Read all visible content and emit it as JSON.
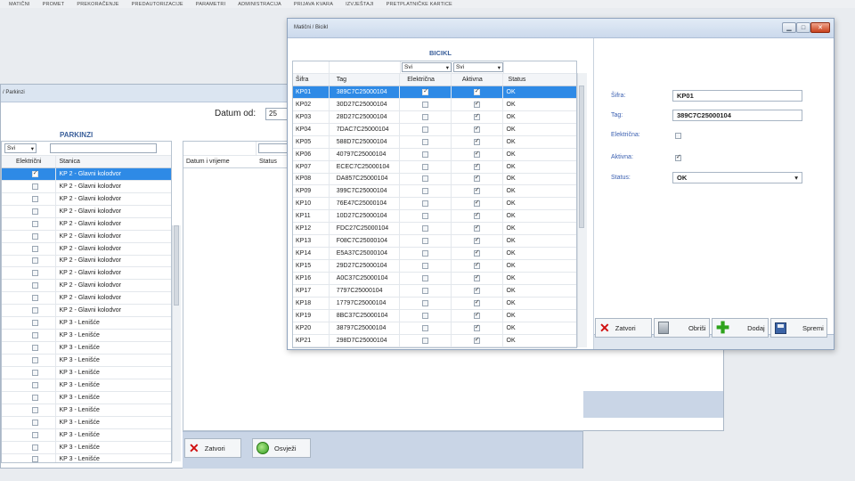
{
  "menu": [
    "MATIČNI",
    "PROMET",
    "PREKORAČENJE",
    "PREDAUTORIZACIJE",
    "PARAMETRI",
    "ADMINISTRACIJA",
    "PRIJAVA KVARA",
    "IZVJEŠTAJI",
    "PRETPLATNIČKE KARTICE"
  ],
  "parkinzi_window": {
    "title": "/ Parkinzi",
    "datum_label": "Datum od:",
    "datum_value": "25",
    "section_title": "PARKINZI",
    "filter_value": "Svi",
    "columns": [
      "Električni",
      "Stanica"
    ],
    "rows": [
      {
        "e": true,
        "station": "KP 2 - Glavni kolodvor",
        "sel": true
      },
      {
        "e": false,
        "station": "KP 2 - Glavni kolodvor"
      },
      {
        "e": false,
        "station": "KP 2 - Glavni kolodvor"
      },
      {
        "e": false,
        "station": "KP 2 - Glavni kolodvor"
      },
      {
        "e": false,
        "station": "KP 2 - Glavni kolodvor"
      },
      {
        "e": false,
        "station": "KP 2 - Glavni kolodvor"
      },
      {
        "e": false,
        "station": "KP 2 - Glavni kolodvor"
      },
      {
        "e": false,
        "station": "KP 2 - Glavni kolodvor"
      },
      {
        "e": false,
        "station": "KP 2 - Glavni kolodvor"
      },
      {
        "e": false,
        "station": "KP 2 - Glavni kolodvor"
      },
      {
        "e": false,
        "station": "KP 2 - Glavni kolodvor"
      },
      {
        "e": false,
        "station": "KP 2 - Glavni kolodvor"
      },
      {
        "e": false,
        "station": "KP 3 - Lenišće"
      },
      {
        "e": false,
        "station": "KP 3 - Lenišće"
      },
      {
        "e": false,
        "station": "KP 3 - Lenišće"
      },
      {
        "e": false,
        "station": "KP 3 - Lenišće"
      },
      {
        "e": false,
        "station": "KP 3 - Lenišće"
      },
      {
        "e": false,
        "station": "KP 3 - Lenišće"
      },
      {
        "e": false,
        "station": "KP 3 - Lenišće"
      },
      {
        "e": false,
        "station": "KP 3 - Lenišće"
      },
      {
        "e": false,
        "station": "KP 3 - Lenišće"
      },
      {
        "e": false,
        "station": "KP 3 - Lenišće"
      },
      {
        "e": false,
        "station": "KP 3 - Lenišće"
      },
      {
        "e": false,
        "station": "KP 3 - Lenišće"
      }
    ],
    "detail_columns": [
      "Datum i vrijeme",
      "Status"
    ],
    "btn_zatvori": "Zatvori",
    "btn_osvjezi": "Osvježi"
  },
  "bicikl_window": {
    "title": "Matični / Bicikl",
    "section_title": "BICIKL",
    "filter_elektricna": "Svi",
    "filter_aktivna": "Svi",
    "columns": [
      "Šifra",
      "Tag",
      "Električna",
      "Aktivna",
      "Status"
    ],
    "rows": [
      {
        "sifra": "KP01",
        "tag": "389C7C25000104",
        "e": true,
        "a": true,
        "status": "OK",
        "sel": true
      },
      {
        "sifra": "KP02",
        "tag": "30D27C25000104",
        "e": false,
        "a": true,
        "status": "OK"
      },
      {
        "sifra": "KP03",
        "tag": "28D27C25000104",
        "e": false,
        "a": true,
        "status": "OK"
      },
      {
        "sifra": "KP04",
        "tag": "7DAC7C25000104",
        "e": false,
        "a": true,
        "status": "OK"
      },
      {
        "sifra": "KP05",
        "tag": "588D7C25000104",
        "e": false,
        "a": true,
        "status": "OK"
      },
      {
        "sifra": "KP06",
        "tag": "40797C25000104",
        "e": false,
        "a": true,
        "status": "OK"
      },
      {
        "sifra": "KP07",
        "tag": "ECEC7C25000104",
        "e": false,
        "a": true,
        "status": "OK"
      },
      {
        "sifra": "KP08",
        "tag": "DA857C25000104",
        "e": false,
        "a": true,
        "status": "OK"
      },
      {
        "sifra": "KP09",
        "tag": "399C7C25000104",
        "e": false,
        "a": true,
        "status": "OK"
      },
      {
        "sifra": "KP10",
        "tag": "76E47C25000104",
        "e": false,
        "a": true,
        "status": "OK"
      },
      {
        "sifra": "KP11",
        "tag": "10D27C25000104",
        "e": false,
        "a": true,
        "status": "OK"
      },
      {
        "sifra": "KP12",
        "tag": "FDC27C25000104",
        "e": false,
        "a": true,
        "status": "OK"
      },
      {
        "sifra": "KP13",
        "tag": "F08C7C25000104",
        "e": false,
        "a": true,
        "status": "OK"
      },
      {
        "sifra": "KP14",
        "tag": "E5A37C25000104",
        "e": false,
        "a": true,
        "status": "OK"
      },
      {
        "sifra": "KP15",
        "tag": "29D27C25000104",
        "e": false,
        "a": true,
        "status": "OK"
      },
      {
        "sifra": "KP16",
        "tag": "A0C37C25000104",
        "e": false,
        "a": true,
        "status": "OK"
      },
      {
        "sifra": "KP17",
        "tag": "7797C25000104",
        "e": false,
        "a": true,
        "status": "OK"
      },
      {
        "sifra": "KP18",
        "tag": "17797C25000104",
        "e": false,
        "a": true,
        "status": "OK"
      },
      {
        "sifra": "KP19",
        "tag": "8BC37C25000104",
        "e": false,
        "a": true,
        "status": "OK"
      },
      {
        "sifra": "KP20",
        "tag": "38797C25000104",
        "e": false,
        "a": true,
        "status": "OK"
      },
      {
        "sifra": "KP21",
        "tag": "298D7C25000104",
        "e": false,
        "a": true,
        "status": "OK"
      }
    ],
    "form": {
      "sifra_label": "Šifra:",
      "sifra_value": "KP01",
      "tag_label": "Tag:",
      "tag_value": "389C7C25000104",
      "elektricna_label": "Električna:",
      "elektricna_checked": false,
      "aktivna_label": "Aktivna:",
      "aktivna_checked": true,
      "status_label": "Status:",
      "status_value": "OK"
    },
    "buttons": {
      "zatvori": "Zatvori",
      "obrisi": "Obriši",
      "dodaj": "Dodaj",
      "spremi": "Spremi"
    }
  },
  "colors": {
    "selection": "#2e8ae6",
    "title_blue": "#3a5f9a",
    "bottom_bar": "#c9d5e6"
  }
}
